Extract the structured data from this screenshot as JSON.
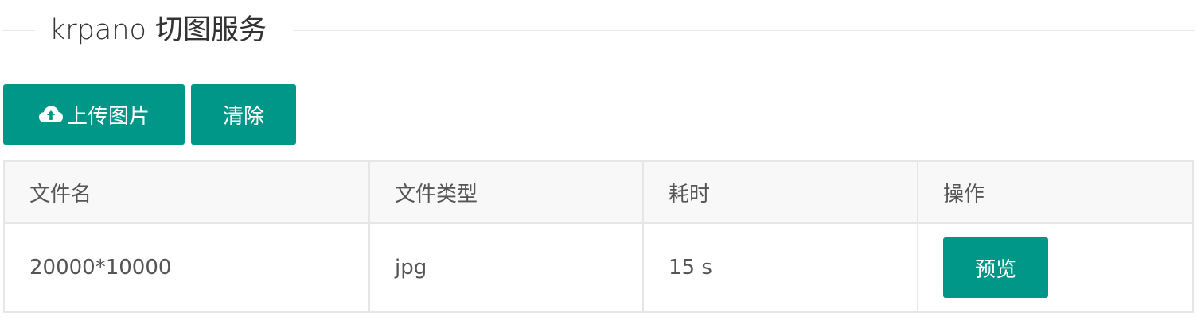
{
  "header": {
    "title": "krpano 切图服务"
  },
  "toolbar": {
    "upload_label": "上传图片",
    "upload_icon": "cloud-upload-icon",
    "clear_label": "清除",
    "accent_color": "#009688"
  },
  "table": {
    "columns": [
      "文件名",
      "文件类型",
      "耗时",
      "操作"
    ],
    "rows": [
      {
        "file_name": "20000*10000",
        "file_type": "jpg",
        "duration": "15 s",
        "action_label": "预览"
      }
    ]
  }
}
